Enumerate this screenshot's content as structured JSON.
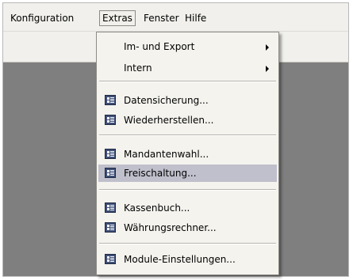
{
  "menubar": {
    "items": [
      {
        "label": "Konfiguration"
      },
      {
        "label": "Extras",
        "active": true
      },
      {
        "label": "Fenster"
      },
      {
        "label": "Hilfe"
      }
    ]
  },
  "extras_menu": {
    "items": [
      {
        "label": "Im- und Export",
        "submenu": true
      },
      {
        "label": "Intern",
        "submenu": true
      },
      {
        "label": "Datensicherung..."
      },
      {
        "label": "Wiederherstellen..."
      },
      {
        "label": "Mandantenwahl..."
      },
      {
        "label": "Freischaltung...",
        "highlighted": true
      },
      {
        "label": "Kassenbuch..."
      },
      {
        "label": "Währungsrechner..."
      },
      {
        "label": "Module-Einstellungen..."
      }
    ]
  },
  "colors": {
    "menu_background": "#f4f3ee",
    "highlight": "#c0c0cc",
    "workspace": "#7f7f7f",
    "menubar": "#f1f0ec"
  },
  "icons": {
    "menu_item_icon": "form-window-icon",
    "submenu_arrow": "triangle-right-icon"
  }
}
